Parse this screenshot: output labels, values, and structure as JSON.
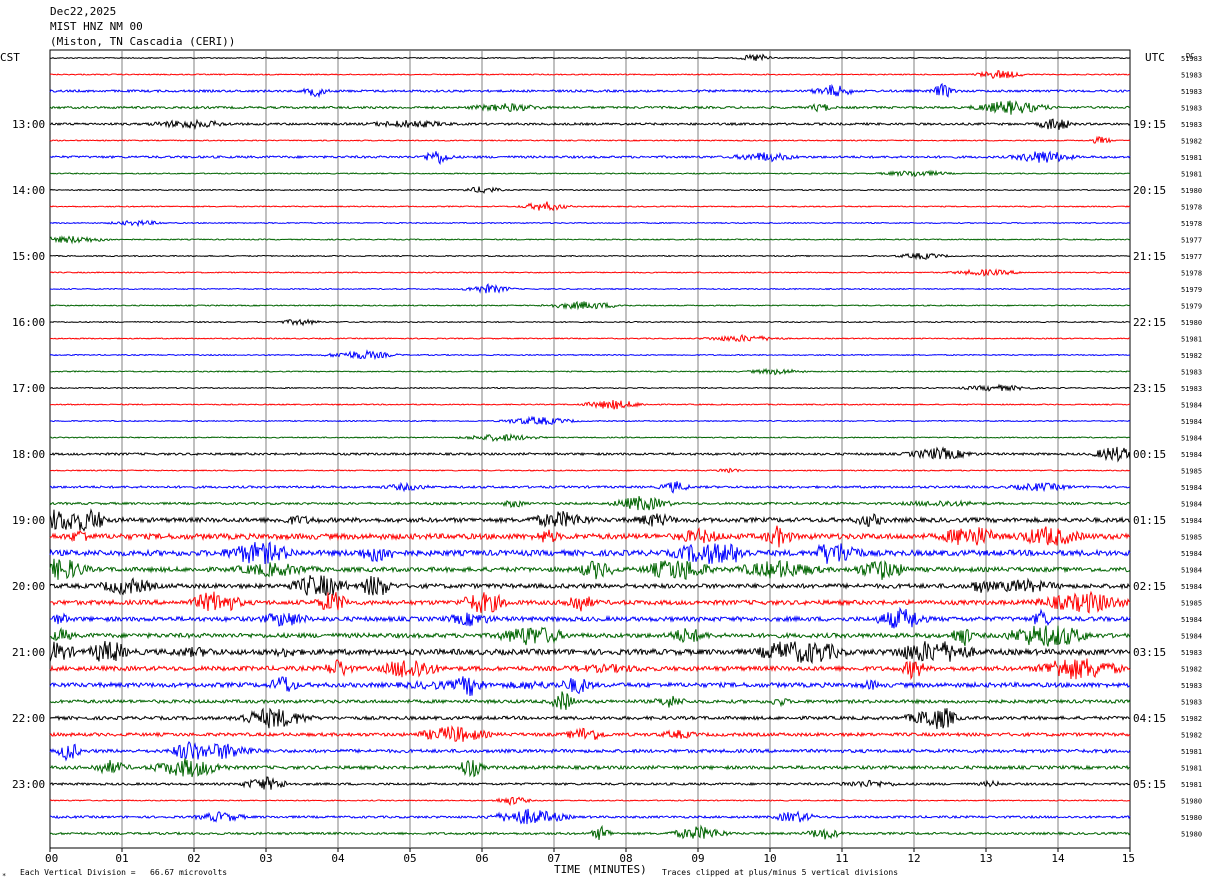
{
  "header": {
    "date": "Dec22,2025",
    "station": "MIST HNZ NM 00",
    "location": "(Miston, TN Cascadia (CERI))"
  },
  "left_zone": "CST",
  "right_zone": "UTC",
  "dc_label": "DC",
  "footer": {
    "scale_note": "Each Vertical Division =   66.67 microvolts",
    "xlabel": "TIME (MINUTES)",
    "clip_note": "Traces clipped at plus/minus 5 vertical divisions",
    "corner_mark": "*"
  },
  "colors": {
    "trace_cycle": [
      "#000000",
      "#ff0000",
      "#0000ff",
      "#006400"
    ],
    "grid": "#808080"
  },
  "chart_data": {
    "type": "line",
    "title": "",
    "xlabel": "TIME (MINUTES)",
    "xlim": [
      0,
      15
    ],
    "x_ticks": [
      "00",
      "01",
      "02",
      "03",
      "04",
      "05",
      "06",
      "07",
      "08",
      "09",
      "10",
      "11",
      "12",
      "13",
      "14",
      "15"
    ],
    "trace_count": 48,
    "trace_interval_minutes": 15,
    "left_hour_labels": [
      {
        "trace": 4,
        "label": "13:00"
      },
      {
        "trace": 8,
        "label": "14:00"
      },
      {
        "trace": 12,
        "label": "15:00"
      },
      {
        "trace": 16,
        "label": "16:00"
      },
      {
        "trace": 20,
        "label": "17:00"
      },
      {
        "trace": 24,
        "label": "18:00"
      },
      {
        "trace": 28,
        "label": "19:00"
      },
      {
        "trace": 32,
        "label": "20:00"
      },
      {
        "trace": 36,
        "label": "21:00"
      },
      {
        "trace": 40,
        "label": "22:00"
      },
      {
        "trace": 44,
        "label": "23:00"
      }
    ],
    "right_hour_labels": [
      {
        "trace": 4,
        "label": "19:15"
      },
      {
        "trace": 8,
        "label": "20:15"
      },
      {
        "trace": 12,
        "label": "21:15"
      },
      {
        "trace": 16,
        "label": "22:15"
      },
      {
        "trace": 20,
        "label": "23:15"
      },
      {
        "trace": 24,
        "label": "00:15"
      },
      {
        "trace": 28,
        "label": "01:15"
      },
      {
        "trace": 32,
        "label": "02:15"
      },
      {
        "trace": 36,
        "label": "03:15"
      },
      {
        "trace": 40,
        "label": "04:15"
      },
      {
        "trace": 44,
        "label": "05:15"
      }
    ],
    "dc_offsets": [
      "51983",
      "51983",
      "51983",
      "51983",
      "51983",
      "51982",
      "51981",
      "51981",
      "51980",
      "51978",
      "51978",
      "51977",
      "51977",
      "51978",
      "51979",
      "51979",
      "51980",
      "51981",
      "51982",
      "51983",
      "51983",
      "51984",
      "51984",
      "51984",
      "51984",
      "51985",
      "51984",
      "51984",
      "51984",
      "51985",
      "51984",
      "51984",
      "51984",
      "51985",
      "51984",
      "51984",
      "51983",
      "51982",
      "51983",
      "51983",
      "51982",
      "51982",
      "51981",
      "51981",
      "51981",
      "51980",
      "51980",
      "51980"
    ],
    "trace_activity": [
      1,
      1,
      2,
      2,
      2,
      1,
      2,
      1,
      1,
      1,
      1,
      1,
      1,
      1,
      1,
      1,
      1,
      1,
      1,
      1,
      1,
      1,
      1,
      1,
      2,
      1,
      2,
      2,
      4,
      5,
      5,
      4,
      4,
      4,
      4,
      4,
      5,
      4,
      4,
      3,
      3,
      3,
      3,
      3,
      2,
      1,
      2,
      2
    ]
  }
}
